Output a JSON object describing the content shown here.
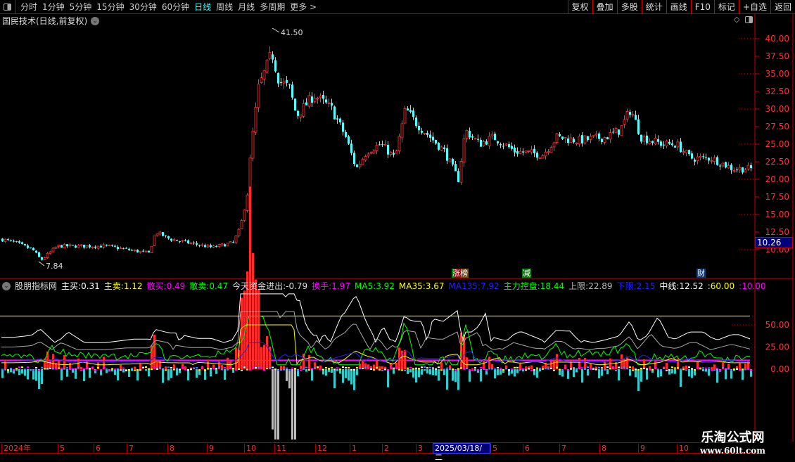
{
  "toolbar": {
    "periods": [
      "分时",
      "1分钟",
      "5分钟",
      "15分钟",
      "30分钟",
      "60分钟",
      "日线",
      "周线",
      "月线",
      "多周期",
      "更多 >"
    ],
    "active_period": "日线",
    "right_buttons": [
      "复权",
      "叠加",
      "多股",
      "统计",
      "画线",
      "F10",
      "标记",
      "+自选",
      "返回"
    ]
  },
  "stock_title": "国民技术(日线,前复权)",
  "price_axis": {
    "ticks": [
      "40.00",
      "37.50",
      "35.00",
      "32.50",
      "30.00",
      "27.50",
      "25.00",
      "22.50",
      "20.00",
      "17.50",
      "15.00",
      "12.50",
      "10.00"
    ],
    "last_price": "10.26"
  },
  "annotations": {
    "high": "41.50",
    "low": "7.84"
  },
  "markers": [
    {
      "text": "涨榜",
      "color": "#8a1010"
    },
    {
      "text": "减",
      "color": "#0a7a0a"
    },
    {
      "text": "财",
      "color": "#123a6a"
    }
  ],
  "indicator": {
    "name": "股朋指标网",
    "items": [
      {
        "label": "主买:",
        "value": "0.31",
        "color": "#ffffff"
      },
      {
        "label": "主卖:",
        "value": "1.12",
        "color": "#ffff00"
      },
      {
        "label": "散买:",
        "value": "0.49",
        "color": "#ff00ff"
      },
      {
        "label": "散卖:",
        "value": "0.47",
        "color": "#00ff00"
      },
      {
        "label": "今天资金进出:",
        "value": "-0.79",
        "color": "#dddddd"
      },
      {
        "label": "换手:",
        "value": "1.97",
        "color": "#ff00ff"
      },
      {
        "label": "MA5:",
        "value": "3.92",
        "color": "#00ff00"
      },
      {
        "label": "MA35:",
        "value": "3.67",
        "color": "#ffff00"
      },
      {
        "label": "MA135:",
        "value": "7.92",
        "color": "#2222ff"
      },
      {
        "label": "主力控盘:",
        "value": "18.44",
        "color": "#00ff00"
      },
      {
        "label": "上限:",
        "value": "22.89",
        "color": "#bbbbbb"
      },
      {
        "label": "下限:",
        "value": "2.15",
        "color": "#2222ff"
      },
      {
        "label": "中线:",
        "value": "12.52",
        "color": "#ffffff"
      },
      {
        "label": ":",
        "value": "60.00",
        "color": "#ffff00"
      },
      {
        "label": ":",
        "value": "10.00",
        "color": "#ff00ff"
      }
    ],
    "axis_ticks": [
      "50.00",
      "25.00",
      "0.00"
    ]
  },
  "date_axis": {
    "labels": [
      "2024年",
      "5",
      "6",
      "7",
      "8",
      "9",
      "10",
      "11",
      "12",
      "1",
      "2",
      "3",
      "5",
      "6",
      "7",
      "8",
      "9",
      "10"
    ],
    "cursor_date": "2025/03/18/二"
  },
  "watermark": {
    "title": "乐淘公式网",
    "url": "www.60lt.com"
  },
  "chart_data": {
    "type": "candlestick",
    "price_range": [
      7.84,
      41.5
    ],
    "close_path": [
      [
        0,
        11.5
      ],
      [
        20,
        11
      ],
      [
        45,
        10
      ],
      [
        57,
        8.5
      ],
      [
        80,
        10.5
      ],
      [
        150,
        10.5
      ],
      [
        210,
        9.5
      ],
      [
        220,
        12.5
      ],
      [
        240,
        11.5
      ],
      [
        300,
        10.3
      ],
      [
        330,
        11
      ],
      [
        340,
        13
      ],
      [
        350,
        18
      ],
      [
        356,
        25
      ],
      [
        366,
        33
      ],
      [
        385,
        38
      ],
      [
        395,
        34
      ],
      [
        410,
        33
      ],
      [
        420,
        29
      ],
      [
        445,
        32
      ],
      [
        470,
        30
      ],
      [
        490,
        26
      ],
      [
        505,
        21.5
      ],
      [
        520,
        24
      ],
      [
        540,
        25
      ],
      [
        560,
        23
      ],
      [
        575,
        30
      ],
      [
        590,
        28
      ],
      [
        610,
        26
      ],
      [
        630,
        24
      ],
      [
        650,
        20
      ],
      [
        660,
        27
      ],
      [
        680,
        25
      ],
      [
        700,
        26
      ],
      [
        730,
        24
      ],
      [
        770,
        23.5
      ],
      [
        790,
        26
      ],
      [
        820,
        25.5
      ],
      [
        860,
        26
      ],
      [
        880,
        27
      ],
      [
        895,
        30
      ],
      [
        910,
        26
      ],
      [
        940,
        25
      ],
      [
        960,
        25
      ],
      [
        980,
        23
      ],
      [
        1010,
        23
      ],
      [
        1040,
        21.5
      ],
      [
        1068,
        21.5
      ]
    ]
  }
}
